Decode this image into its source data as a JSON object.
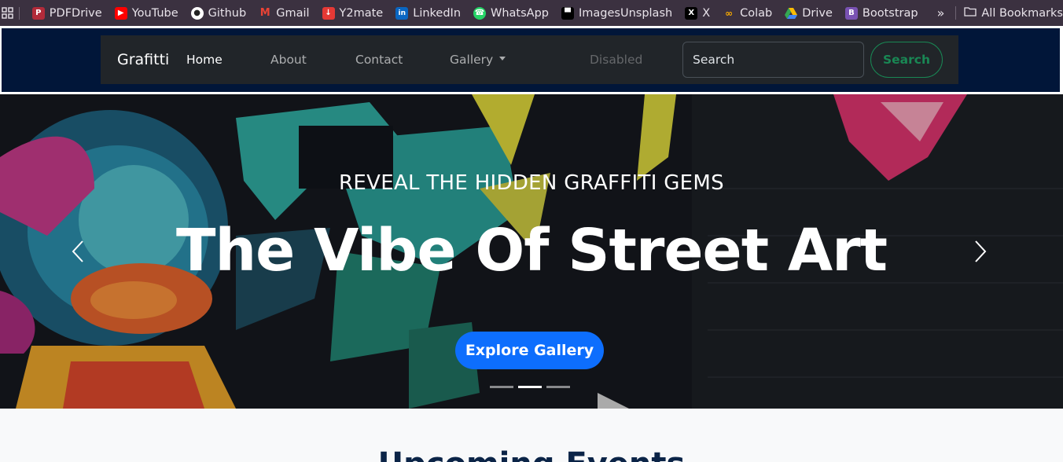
{
  "bookmarks": {
    "items": [
      {
        "label": "PDFDrive",
        "icon": "pdfdrive-icon",
        "color": "#b22b3a"
      },
      {
        "label": "YouTube",
        "icon": "youtube-icon",
        "color": "#ff0000"
      },
      {
        "label": "Github",
        "icon": "github-icon",
        "color": "#ffffff"
      },
      {
        "label": "Gmail",
        "icon": "gmail-icon",
        "color": "#ea4335"
      },
      {
        "label": "Y2mate",
        "icon": "y2mate-icon",
        "color": "#e53935"
      },
      {
        "label": "LinkedIn",
        "icon": "linkedin-icon",
        "color": "#0a66c2"
      },
      {
        "label": "WhatsApp",
        "icon": "whatsapp-icon",
        "color": "#25d366"
      },
      {
        "label": "ImagesUnsplash",
        "icon": "unsplash-icon",
        "color": "#000000"
      },
      {
        "label": "X",
        "icon": "x-icon",
        "color": "#000000"
      },
      {
        "label": "Colab",
        "icon": "colab-icon",
        "color": "#f9ab00"
      },
      {
        "label": "Drive",
        "icon": "drive-icon",
        "color": "#34a853"
      },
      {
        "label": "Bootstrap",
        "icon": "bootstrap-icon",
        "color": "#7952b3"
      }
    ],
    "more": "»",
    "all_label": "All Bookmarks"
  },
  "navbar": {
    "brand": "Grafitti",
    "links": {
      "home": "Home",
      "about": "About",
      "contact": "Contact",
      "gallery": "Gallery",
      "disabled": "Disabled"
    },
    "search_placeholder": "Search",
    "search_button": "Search",
    "colors": {
      "frame": "#011639",
      "bar": "#212529",
      "success": "#198754"
    }
  },
  "hero": {
    "kicker": "REVEAL THE HIDDEN GRAFFITI GEMS",
    "headline": "The Vibe Of Street Art",
    "cta": "Explore Gallery",
    "indicators": 3,
    "active_indicator": 2,
    "cta_color": "#0d6efd"
  },
  "events": {
    "title": "Upcoming Events"
  }
}
